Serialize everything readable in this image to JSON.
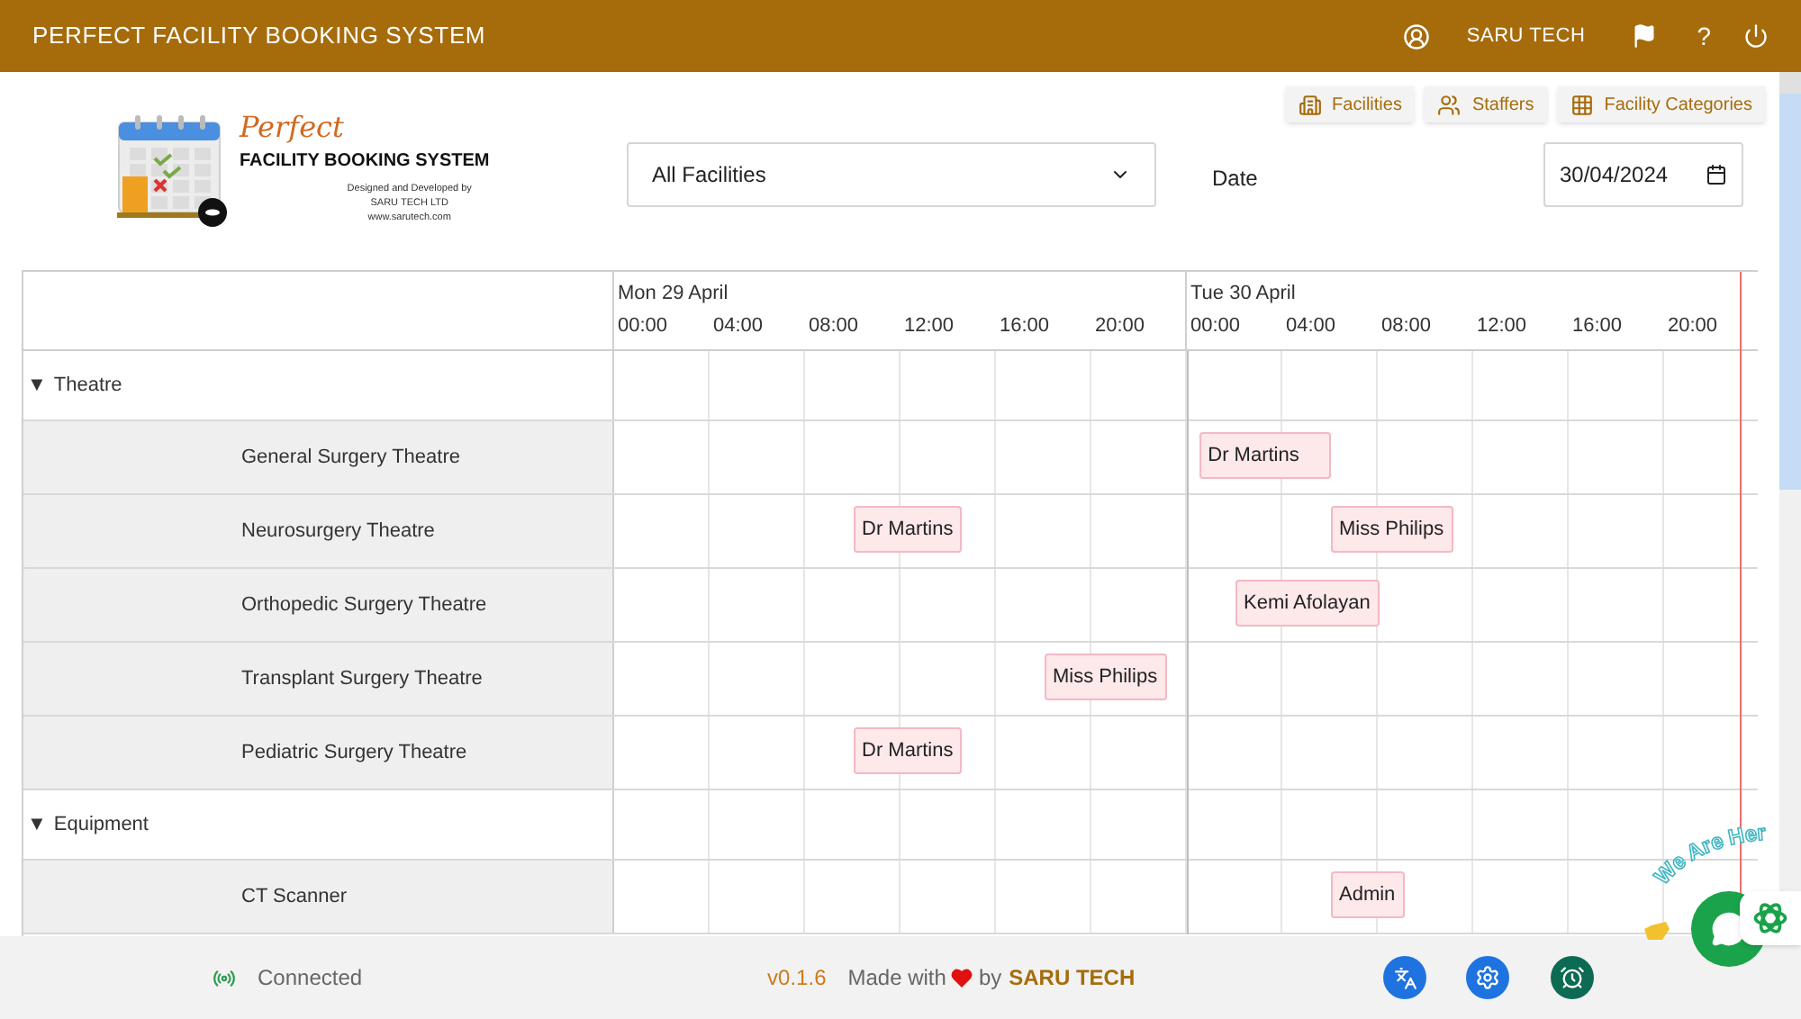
{
  "app_bar": {
    "title": "PERFECT FACILITY BOOKING SYSTEM",
    "user": "SARU TECH",
    "help": "?"
  },
  "nav_buttons": [
    {
      "kind": "facilities",
      "label": "Facilities"
    },
    {
      "kind": "staffers",
      "label": "Staffers"
    },
    {
      "kind": "categories",
      "label": "Facility Categories"
    }
  ],
  "logo": {
    "brand": "Perfect",
    "name": "FACILITY BOOKING SYSTEM",
    "credit_lines": [
      "Designed and Developed by",
      "SARU TECH LTD",
      "www.sarutech.com"
    ]
  },
  "filters": {
    "facility_select": "All Facilities",
    "date_label": "Date",
    "date_value": "30/04/2024"
  },
  "timeline": {
    "days": [
      {
        "label": "Mon 29 April",
        "hours": [
          "00:00",
          "04:00",
          "08:00",
          "12:00",
          "16:00",
          "20:00"
        ]
      },
      {
        "label": "Tue 30 April",
        "hours": [
          "00:00",
          "04:00",
          "08:00",
          "12:00",
          "16:00",
          "20:00"
        ]
      }
    ],
    "groups": [
      {
        "toggle": "▼",
        "name": "Theatre",
        "expanded": true,
        "facilities": [
          {
            "name": "General Surgery Theatre",
            "bookings": [
              {
                "label": "Dr Martins"
              }
            ]
          },
          {
            "name": "Neurosurgery Theatre",
            "bookings": [
              {
                "label": "Dr Martins"
              },
              {
                "label": "Miss Philips"
              }
            ]
          },
          {
            "name": "Orthopedic Surgery Theatre",
            "bookings": [
              {
                "label": "Kemi Afolayan"
              }
            ]
          },
          {
            "name": "Transplant Surgery Theatre",
            "bookings": [
              {
                "label": "Miss Philips"
              }
            ]
          },
          {
            "name": "Pediatric Surgery Theatre",
            "bookings": [
              {
                "label": "Dr Martins"
              }
            ]
          }
        ]
      },
      {
        "toggle": "▼",
        "name": "Equipment",
        "expanded": true,
        "facilities": [
          {
            "name": "CT Scanner",
            "bookings": [
              {
                "label": "Admin"
              }
            ]
          }
        ]
      }
    ]
  },
  "footer": {
    "status": "Connected",
    "version": "v0.1.6",
    "made_with": "Made with",
    "by": "by",
    "company": "SARU TECH"
  },
  "chat_widget": {
    "caption": "We Are Her"
  }
}
